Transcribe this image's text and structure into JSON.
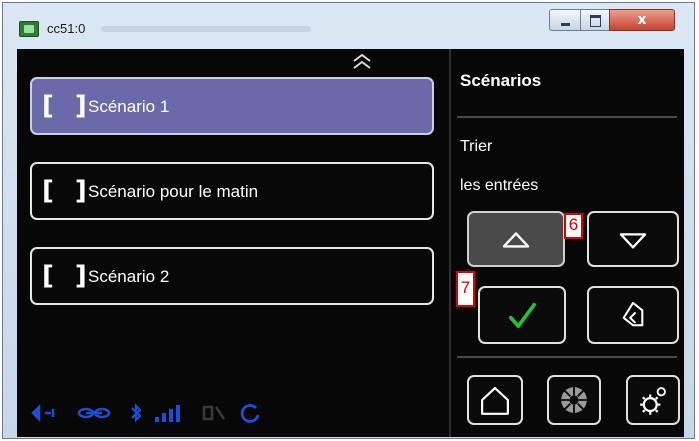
{
  "window": {
    "title": "cc51:0",
    "close_glyph": "x",
    "controls": [
      "minimize-icon",
      "maximize-icon",
      "close-icon"
    ]
  },
  "list": {
    "items": [
      {
        "bracket": "[ ]",
        "label": "Scénario 1",
        "selected": true
      },
      {
        "bracket": "[ ]",
        "label": "Scénario pour le matin",
        "selected": false
      },
      {
        "bracket": "[ ]",
        "label": "Scénario 2",
        "selected": false
      }
    ],
    "scroll_up_icon": "double-chevron-up-icon"
  },
  "panel": {
    "title": "Scénarios",
    "sort_line1": "Trier",
    "sort_line2": "les entrées",
    "buttons": {
      "move_up": "triangle-up-icon",
      "move_down": "triangle-down-icon",
      "confirm": "checkmark-icon",
      "back": "back-arrow-icon",
      "home": "home-icon",
      "scenes": "aperture-icon",
      "settings": "gear-icon"
    }
  },
  "markers": {
    "m6": "6",
    "m7": "7"
  },
  "status_bar": {
    "icons": [
      "network-icon",
      "link-icon",
      "bluetooth-icon",
      "signal-icon",
      "status-icon",
      "refresh-icon"
    ]
  },
  "colors": {
    "screen_bg": "#070707",
    "selected_item": "#6a69a9",
    "confirm_check": "#22c232",
    "status_icons": "#1c4fd6",
    "marker_red": "#e00000"
  }
}
